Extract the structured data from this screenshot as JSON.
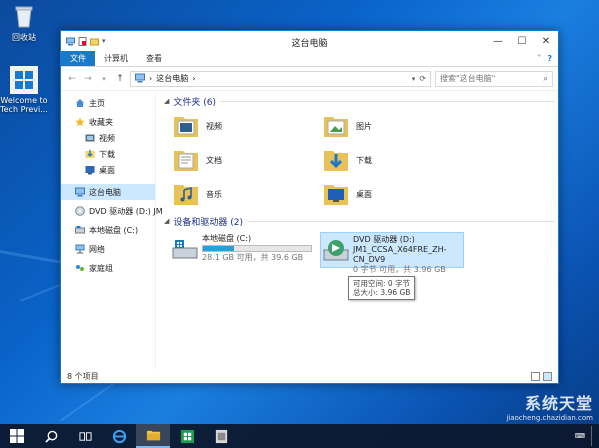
{
  "desktop": {
    "icons": [
      {
        "label": "回收站",
        "icon": "recycle-bin-icon"
      },
      {
        "label": "Welcome to Tech Previ...",
        "icon": "windows-logo-icon"
      }
    ]
  },
  "window": {
    "title": "这台电脑",
    "ribbon_tabs": [
      "文件",
      "计算机",
      "查看"
    ],
    "address": {
      "location": "这台电脑",
      "separator": "›"
    },
    "search_placeholder": "搜索\"这台电脑\"",
    "navigation": [
      {
        "label": "主页",
        "icon": "home-icon"
      },
      {
        "label": "收藏夹",
        "icon": "star-icon"
      },
      {
        "label": "视频",
        "icon": "video-folder-icon"
      },
      {
        "label": "下载",
        "icon": "download-folder-icon"
      },
      {
        "label": "桌面",
        "icon": "desktop-icon"
      },
      {
        "label": "这台电脑",
        "icon": "computer-icon"
      },
      {
        "label": "DVD 驱动器 (D:) JM",
        "icon": "dvd-icon"
      },
      {
        "label": "本地磁盘 (C:)",
        "icon": "drive-icon"
      },
      {
        "label": "网络",
        "icon": "network-icon"
      },
      {
        "label": "家庭组",
        "icon": "homegroup-icon"
      }
    ],
    "folders_group": {
      "title": "文件夹 (6)"
    },
    "folders": [
      {
        "name": "视频",
        "icon": "videos-folder-icon"
      },
      {
        "name": "图片",
        "icon": "pictures-folder-icon"
      },
      {
        "name": "文档",
        "icon": "documents-folder-icon"
      },
      {
        "name": "下载",
        "icon": "downloads-folder-icon"
      },
      {
        "name": "音乐",
        "icon": "music-folder-icon"
      },
      {
        "name": "桌面",
        "icon": "desktop-folder-icon"
      }
    ],
    "devices_group": {
      "title": "设备和驱动器 (2)"
    },
    "drives": [
      {
        "name": "本地磁盘 (C:)",
        "info": "28.1 GB 可用，共 39.6 GB",
        "used_fraction": 0.29
      },
      {
        "name": "DVD 驱动器 (D:)",
        "label": "JM1_CCSA_X64FRE_ZH-CN_DV9",
        "info": "0 字节 可用，共 3.96 GB"
      }
    ],
    "tooltip": {
      "line1": "可用空间: 0 字节",
      "line2": "总大小: 3.96 GB"
    },
    "status": "8 个项目"
  },
  "watermark": {
    "line1": "系统天堂",
    "line2": "jiaocheng.chazidian.com"
  },
  "colors": {
    "accent": "#1979ca",
    "selection": "#cce8ff",
    "group_header": "#1e3287",
    "progress": "#26a0da"
  }
}
